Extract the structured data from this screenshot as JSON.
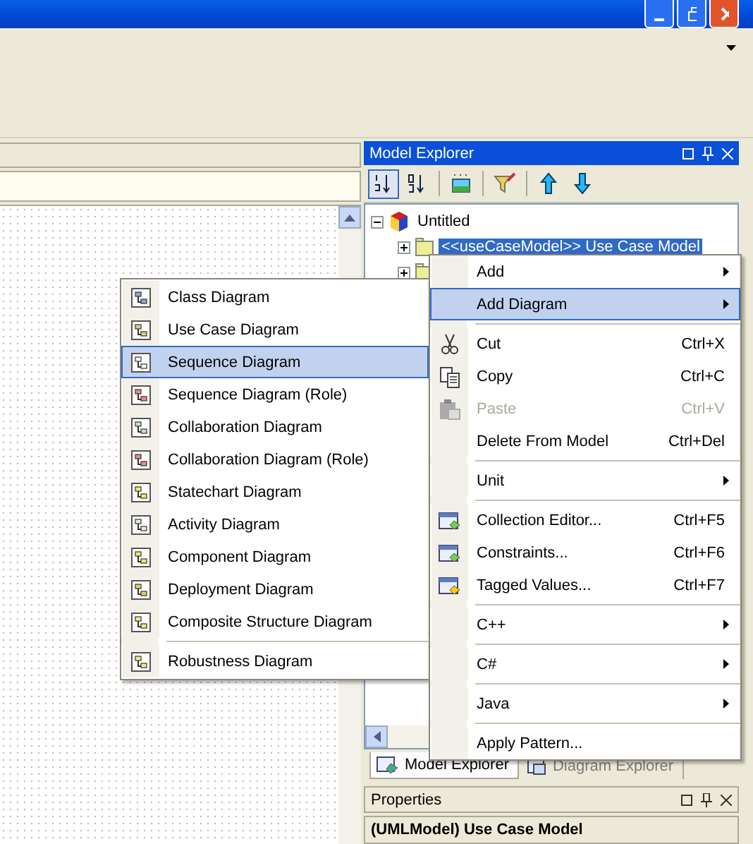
{
  "explorer": {
    "title": "Model Explorer",
    "toolbar": [
      {
        "selected": true
      },
      {
        "selected": false
      },
      {
        "selected": false
      },
      {
        "selected": false
      },
      {
        "selected": false
      },
      {
        "selected": false
      }
    ],
    "tree": [
      {
        "label": "Untitled",
        "selected": false,
        "expanded": true,
        "children": [
          {
            "label": "<<useCaseModel>> Use Case Model",
            "selected": true,
            "expanded": false
          },
          {
            "expanded": false
          }
        ]
      }
    ]
  },
  "tabs": [
    {
      "label": "Model Explorer",
      "selected": true
    },
    {
      "label": "Diagram Explorer",
      "selected": false
    }
  ],
  "properties": {
    "title": "Properties",
    "header": "(UMLModel) Use Case Model"
  },
  "context_menu": [
    {
      "kind": "item",
      "label": "Add",
      "submenu": true,
      "selected": false,
      "disabled": false
    },
    {
      "kind": "item",
      "label": "Add Diagram",
      "submenu": true,
      "selected": true,
      "disabled": false
    },
    {
      "kind": "separator"
    },
    {
      "kind": "item",
      "label": "Cut",
      "shortcut": "Ctrl+X",
      "submenu": false,
      "selected": false,
      "disabled": false
    },
    {
      "kind": "item",
      "label": "Copy",
      "shortcut": "Ctrl+C",
      "submenu": false,
      "selected": false,
      "disabled": false
    },
    {
      "kind": "item",
      "label": "Paste",
      "shortcut": "Ctrl+V",
      "submenu": false,
      "selected": false,
      "disabled": true
    },
    {
      "kind": "item",
      "label": "Delete From Model",
      "shortcut": "Ctrl+Del",
      "submenu": false,
      "selected": false,
      "disabled": false
    },
    {
      "kind": "separator"
    },
    {
      "kind": "item",
      "label": "Unit",
      "submenu": true,
      "selected": false,
      "disabled": false
    },
    {
      "kind": "separator"
    },
    {
      "kind": "item",
      "label": "Collection Editor...",
      "shortcut": "Ctrl+F5",
      "submenu": false,
      "selected": false,
      "disabled": false
    },
    {
      "kind": "item",
      "label": "Constraints...",
      "shortcut": "Ctrl+F6",
      "submenu": false,
      "selected": false,
      "disabled": false
    },
    {
      "kind": "item",
      "label": "Tagged Values...",
      "shortcut": "Ctrl+F7",
      "submenu": false,
      "selected": false,
      "disabled": false
    },
    {
      "kind": "separator"
    },
    {
      "kind": "item",
      "label": "C++",
      "submenu": true,
      "selected": false,
      "disabled": false
    },
    {
      "kind": "separator"
    },
    {
      "kind": "item",
      "label": "C#",
      "submenu": true,
      "selected": false,
      "disabled": false
    },
    {
      "kind": "separator"
    },
    {
      "kind": "item",
      "label": "Java",
      "submenu": true,
      "selected": false,
      "disabled": false
    },
    {
      "kind": "separator"
    },
    {
      "kind": "item",
      "label": "Apply Pattern...",
      "submenu": false,
      "selected": false,
      "disabled": false
    }
  ],
  "submenu": [
    {
      "kind": "item",
      "label": "Class Diagram",
      "selected": false
    },
    {
      "kind": "item",
      "label": "Use Case Diagram",
      "selected": false
    },
    {
      "kind": "item",
      "label": "Sequence Diagram",
      "selected": true
    },
    {
      "kind": "item",
      "label": "Sequence Diagram (Role)",
      "selected": false
    },
    {
      "kind": "item",
      "label": "Collaboration Diagram",
      "selected": false
    },
    {
      "kind": "item",
      "label": "Collaboration Diagram (Role)",
      "selected": false
    },
    {
      "kind": "item",
      "label": "Statechart Diagram",
      "selected": false
    },
    {
      "kind": "item",
      "label": "Activity Diagram",
      "selected": false
    },
    {
      "kind": "item",
      "label": "Component Diagram",
      "selected": false
    },
    {
      "kind": "item",
      "label": "Deployment Diagram",
      "selected": false
    },
    {
      "kind": "item",
      "label": "Composite Structure Diagram",
      "selected": false
    },
    {
      "kind": "separator"
    },
    {
      "kind": "item",
      "label": "Robustness Diagram",
      "selected": false
    }
  ]
}
